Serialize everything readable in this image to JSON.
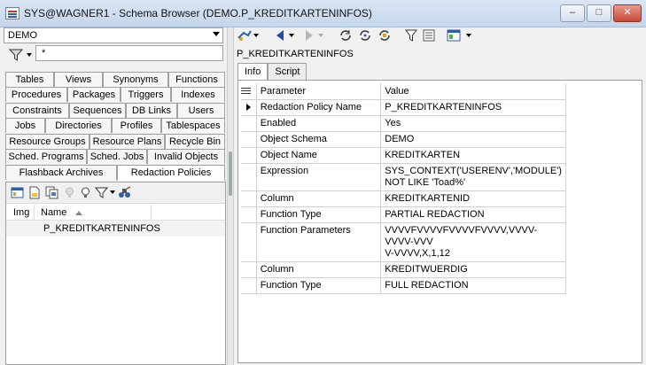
{
  "window": {
    "title": "SYS@WAGNER1 - Schema Browser (DEMO.P_KREDITKARTENINFOS)",
    "minimize": "–",
    "maximize": "□",
    "close": "✕"
  },
  "left": {
    "schema_value": "DEMO",
    "filter_value": "*",
    "tab_rows": [
      [
        "Tables",
        "Views",
        "Synonyms",
        "Functions"
      ],
      [
        "Procedures",
        "Packages",
        "Triggers",
        "Indexes"
      ],
      [
        "Constraints",
        "Sequences",
        "DB Links",
        "Users"
      ],
      [
        "Jobs",
        "Directories",
        "Profiles",
        "Tablespaces"
      ],
      [
        "Resource Groups",
        "Resource Plans",
        "Recycle Bin"
      ],
      [
        "Sched. Programs",
        "Sched. Jobs",
        "Invalid Objects"
      ],
      [
        "Flashback Archives",
        "Redaction Policies"
      ]
    ],
    "list": {
      "col_img": "Img",
      "col_name": "Name",
      "items": [
        "P_KREDITKARTENINFOS"
      ]
    }
  },
  "right": {
    "object_name": "P_KREDITKARTENINFOS",
    "tabs": [
      "Info",
      "Script"
    ],
    "grid": {
      "col_parameter": "Parameter",
      "col_value": "Value",
      "rows": [
        {
          "param": "Redaction Policy Name",
          "value": "P_KREDITKARTENINFOS"
        },
        {
          "param": "Enabled",
          "value": "Yes"
        },
        {
          "param": "Object Schema",
          "value": "DEMO"
        },
        {
          "param": "Object Name",
          "value": "KREDITKARTEN"
        },
        {
          "param": "Expression",
          "value": "SYS_CONTEXT('USERENV','MODULE')\nNOT LIKE 'Toad%'"
        },
        {
          "param": "Column",
          "value": "KREDITKARTENID"
        },
        {
          "param": "Function Type",
          "value": "PARTIAL REDACTION"
        },
        {
          "param": "Function Parameters",
          "value": "VVVVFVVVVFVVVVFVVVV,VVVV-VVVV-VVV\nV-VVVV,X,1,12"
        },
        {
          "param": "Column",
          "value": "KREDITWUERDIG"
        },
        {
          "param": "Function Type",
          "value": "FULL REDACTION"
        }
      ]
    }
  },
  "colors": {
    "accent": "#1f4fa3",
    "title_bar": "#c4d6ec",
    "close": "#c7493a"
  }
}
